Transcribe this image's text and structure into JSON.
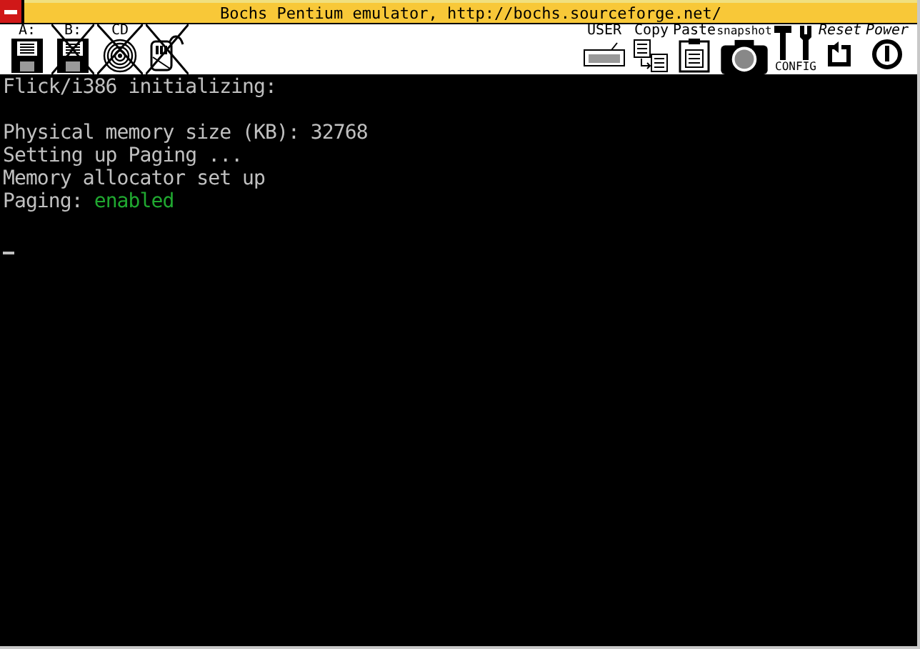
{
  "window": {
    "title": "Bochs Pentium emulator, http://bochs.sourceforge.net/"
  },
  "toolbar": {
    "left": [
      {
        "kind": "floppy",
        "label": "A:",
        "disabled": false
      },
      {
        "kind": "floppy",
        "label": "B:",
        "disabled": true
      },
      {
        "kind": "cdrom",
        "label": "CD",
        "disabled": true
      },
      {
        "kind": "mouse",
        "disabled": true
      }
    ],
    "right": [
      {
        "kind": "keyboard",
        "label": "USER"
      },
      {
        "kind": "copy",
        "label": "Copy"
      },
      {
        "kind": "paste",
        "label": "Paste"
      },
      {
        "kind": "snapshot",
        "label": "snapshot"
      },
      {
        "kind": "config",
        "label": "CONFIG"
      },
      {
        "kind": "reset",
        "label": "Reset"
      },
      {
        "kind": "power",
        "label": "Power"
      }
    ]
  },
  "console": {
    "lines": [
      {
        "kind": "text",
        "segments": [
          {
            "text": "Flick/i386 initializing:",
            "color": "#c0c0c0"
          }
        ]
      },
      {
        "kind": "blank"
      },
      {
        "kind": "text",
        "segments": [
          {
            "text": "Physical memory size (KB): 32768",
            "color": "#c0c0c0"
          }
        ]
      },
      {
        "kind": "text",
        "segments": [
          {
            "text": "Setting up Paging ...",
            "color": "#c0c0c0"
          }
        ]
      },
      {
        "kind": "text",
        "segments": [
          {
            "text": "Memory allocator set up",
            "color": "#c0c0c0"
          }
        ]
      },
      {
        "kind": "text",
        "segments": [
          {
            "text": "Paging: ",
            "color": "#c0c0c0"
          },
          {
            "text": "enabled",
            "color": "#20a830"
          }
        ]
      },
      {
        "kind": "blank"
      },
      {
        "kind": "cursor"
      }
    ]
  }
}
